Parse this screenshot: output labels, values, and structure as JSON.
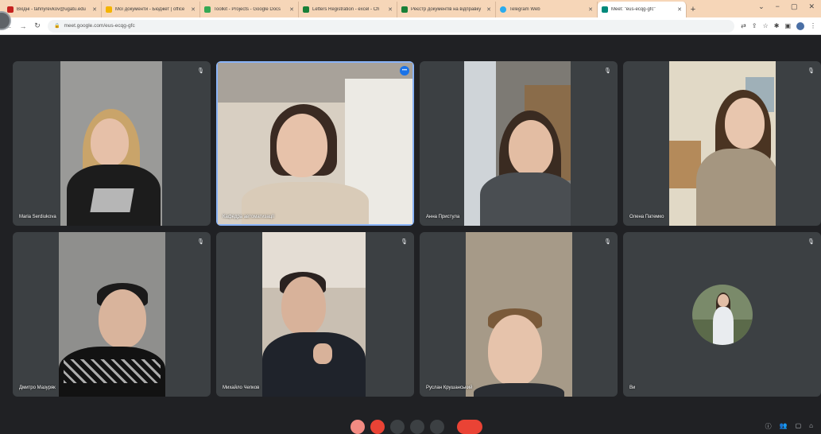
{
  "browser": {
    "tabs": [
      {
        "title": "Вхідні - tahnyrevkov@ugatu.edu",
        "color": "#c5221f"
      },
      {
        "title": "Мої документи - Бюджет | office",
        "color": "#f4b400"
      },
      {
        "title": "Toolkit - Projects - Google Docs",
        "color": "#34a853"
      },
      {
        "title": "Letters Registration - excel - Ch",
        "color": "#188038"
      },
      {
        "title": "Реєстр документів на відправку",
        "color": "#188038"
      },
      {
        "title": "Telegram Web",
        "color": "#2aabee"
      }
    ],
    "active_tab": {
      "title": "Meet: \"eus-ecqg-gfc\"",
      "color": "#00897b"
    },
    "url": "meet.google.com/eus-ecqg-gfc"
  },
  "participants": [
    {
      "name": "Maria Serdiukova",
      "speaking": false
    },
    {
      "name": "Кафедра автоматизації",
      "speaking": true
    },
    {
      "name": "Анна Пристула",
      "speaking": false
    },
    {
      "name": "Олена Патемко",
      "speaking": false
    },
    {
      "name": "Дмитро Мазуряк",
      "speaking": false
    },
    {
      "name": "Михайло Чепков",
      "speaking": false
    },
    {
      "name": "Руслан Крушанський",
      "speaking": false
    },
    {
      "name": "Ви",
      "speaking": false
    }
  ],
  "colors": {
    "meet_background": "#202124",
    "tile_background": "#3c4043",
    "speaking_outline": "#8ab4f8",
    "leave_button": "#ea4335"
  }
}
